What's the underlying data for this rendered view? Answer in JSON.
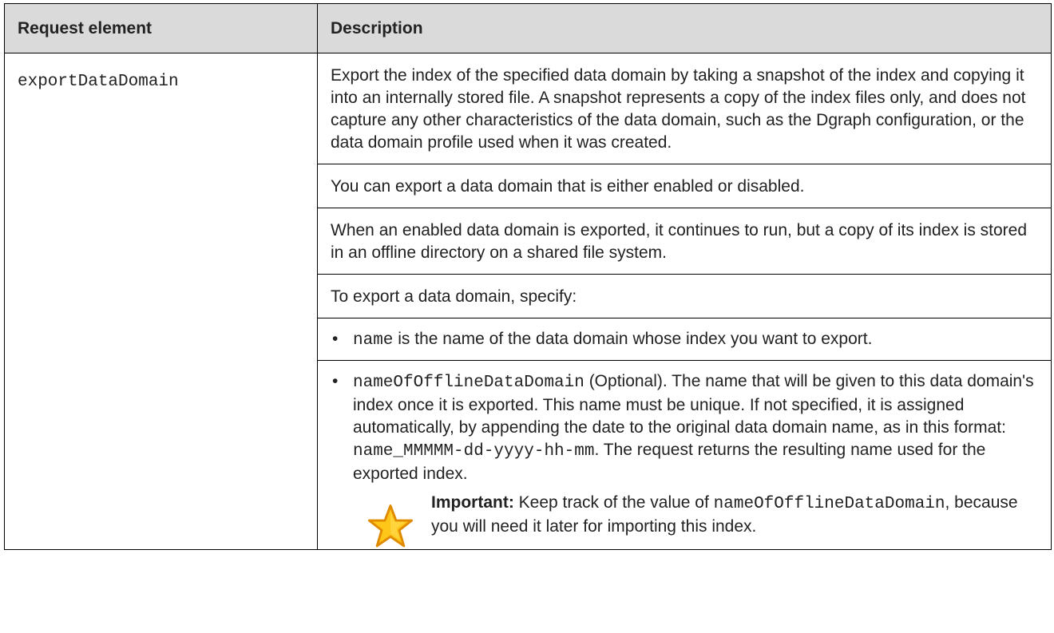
{
  "table": {
    "headers": [
      "Request element",
      "Description"
    ],
    "row": {
      "element": "exportDataDomain",
      "paragraphs": [
        "Export the index of the specified data domain by taking a snapshot of the index and copying it into an internally stored file. A snapshot represents a copy of the index files only, and does not capture any other characteristics of the data domain, such as the Dgraph configuration, or the data domain profile used when it was created.",
        "You can export a data domain that is either enabled or disabled.",
        "When an enabled data domain is exported, it continues to run, but a copy of its index is stored in an offline directory on a shared file system.",
        "To export a data domain, specify:"
      ],
      "bullets": [
        {
          "code": "name",
          "text": " is the name of the data domain whose index you want to export."
        },
        {
          "code": "nameOfOfflineDataDomain",
          "text_a": " (Optional). The name that will be given to this data domain's index once it is exported. This name must be unique. If not specified, it is assigned automatically, by appending the date to the original data domain name, as in this format: ",
          "code2": "name_MMMMM-dd-yyyy-hh-mm",
          "text_b": ". The request returns the resulting name used for the exported index."
        }
      ],
      "note": {
        "icon": "star-icon",
        "label": "Important:",
        "text_a": " Keep track of the value of ",
        "code": "nameOfOfflineDataDomain",
        "text_b": ", because you will need it later for importing this index."
      }
    }
  },
  "colors": {
    "header_bg": "#dadada",
    "star_fill": "#ffc61a",
    "star_stroke": "#e08a00"
  }
}
